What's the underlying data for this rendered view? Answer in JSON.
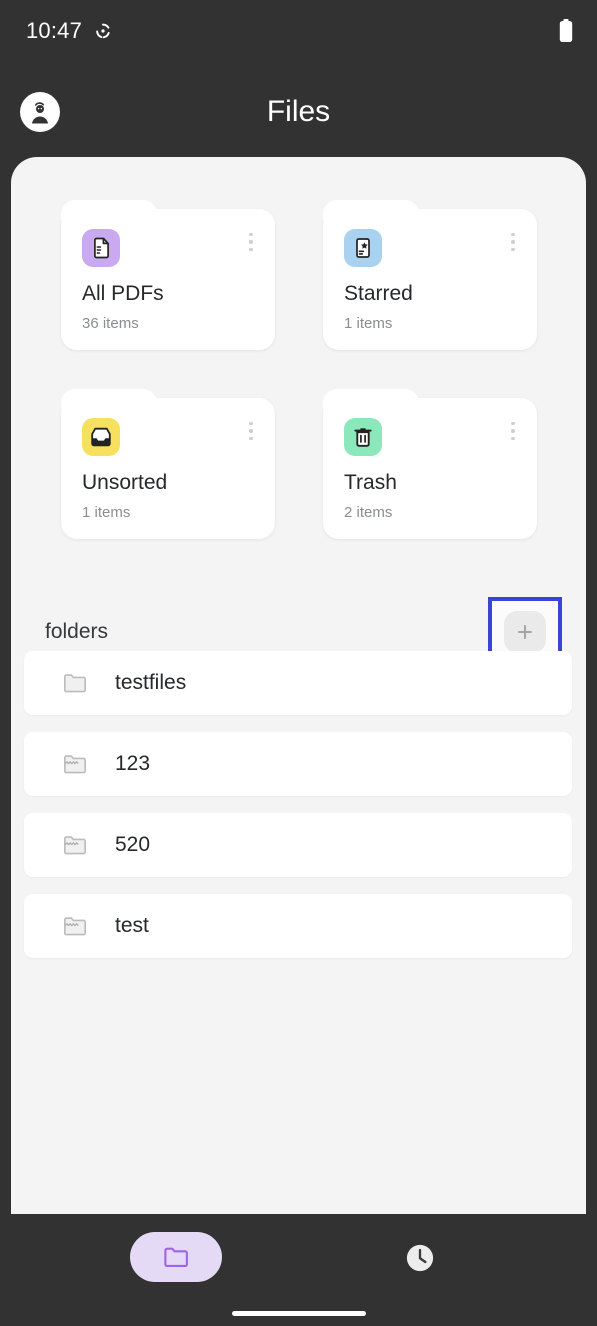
{
  "status_bar": {
    "time": "10:47",
    "sync_icon": "sync-icon",
    "battery_icon": "battery-full-icon"
  },
  "app_bar": {
    "title": "Files",
    "avatar_icon": "avatar-person-icon"
  },
  "categories": [
    {
      "title": "All PDFs",
      "count": "36 items",
      "icon": "pdf-documents-icon",
      "icon_bg": "#c9aaf0",
      "menu_icon": "kebab-menu-icon"
    },
    {
      "title": "Starred",
      "count": "1 items",
      "icon": "starred-document-icon",
      "icon_bg": "#a8d2f0",
      "menu_icon": "kebab-menu-icon"
    },
    {
      "title": "Unsorted",
      "count": "1 items",
      "icon": "inbox-tray-icon",
      "icon_bg": "#f7e05e",
      "menu_icon": "kebab-menu-icon"
    },
    {
      "title": "Trash",
      "count": "2 items",
      "icon": "trash-can-icon",
      "icon_bg": "#8ae8bb",
      "menu_icon": "kebab-menu-icon"
    }
  ],
  "folders_section": {
    "label": "folders",
    "add_button_icon": "plus-icon",
    "highlight_color": "#3a43d4",
    "items": [
      {
        "name": "testfiles",
        "icon": "folder-icon"
      },
      {
        "name": "123",
        "icon": "folder-hatched-icon"
      },
      {
        "name": "520",
        "icon": "folder-hatched-icon"
      },
      {
        "name": "test",
        "icon": "folder-hatched-icon"
      }
    ]
  },
  "bottom_nav": {
    "items": [
      {
        "name": "folders",
        "icon": "folder-icon",
        "active": true
      },
      {
        "name": "recent",
        "icon": "clock-icon",
        "active": false
      }
    ],
    "active_pill_color": "#e5daf6",
    "active_icon_color": "#a063e8"
  }
}
